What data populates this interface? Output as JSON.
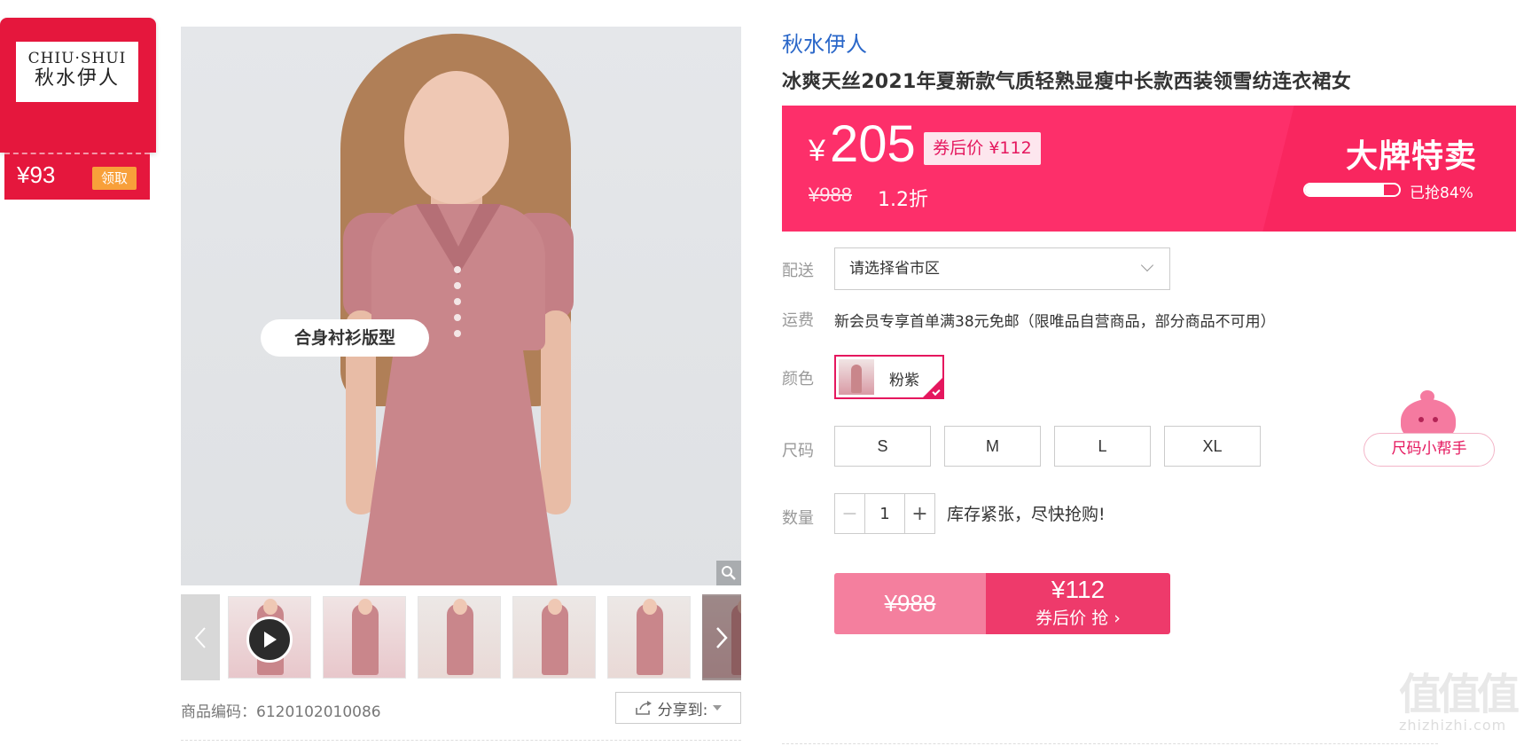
{
  "coupon_card": {
    "brand_en": "CHIU·SHUI",
    "brand_cn": "秋水伊人",
    "amount": "¥93",
    "claim_label": "领取"
  },
  "gallery": {
    "overlay_tag": "合身衬衫版型",
    "thumb_count": 6,
    "product_code_label": "商品编码：",
    "product_code": "6120102010086",
    "share_label": "分享到:"
  },
  "product": {
    "brand": "秋水伊人",
    "title": "冰爽天丝2021年夏新款气质轻熟显瘦中长款西装领雪纺连衣裙女"
  },
  "price_banner": {
    "currency": "¥",
    "price": "205",
    "coupon_price": "券后价 ¥112",
    "original_price": "¥988",
    "discount": "1.2折",
    "promo_title": "大牌特卖",
    "sold_fraction": 0.84,
    "sold_text": "已抢84%"
  },
  "delivery": {
    "label": "配送",
    "select_placeholder": "请选择省市区"
  },
  "shipping": {
    "label": "运费",
    "text": "新会员专享首单满38元免邮（限唯品自营商品，部分商品不可用）"
  },
  "color": {
    "label": "颜色",
    "selected": "粉紫"
  },
  "size": {
    "label": "尺码",
    "options": [
      "S",
      "M",
      "L",
      "XL"
    ],
    "helper_label": "尺码小帮手"
  },
  "quantity": {
    "label": "数量",
    "minus": "−",
    "value": "1",
    "plus": "+",
    "note": "库存紧张，尽快抢购!"
  },
  "buy": {
    "original_price": "¥988",
    "coupon_price": "¥112",
    "action_label": "券后价 抢 ›"
  },
  "watermark": {
    "main": "值值值",
    "site": "zhizhizhi.com"
  },
  "colors": {
    "accent": "#fd2f6a",
    "brand_red": "#e5173d",
    "link_blue": "#2a67c9"
  }
}
